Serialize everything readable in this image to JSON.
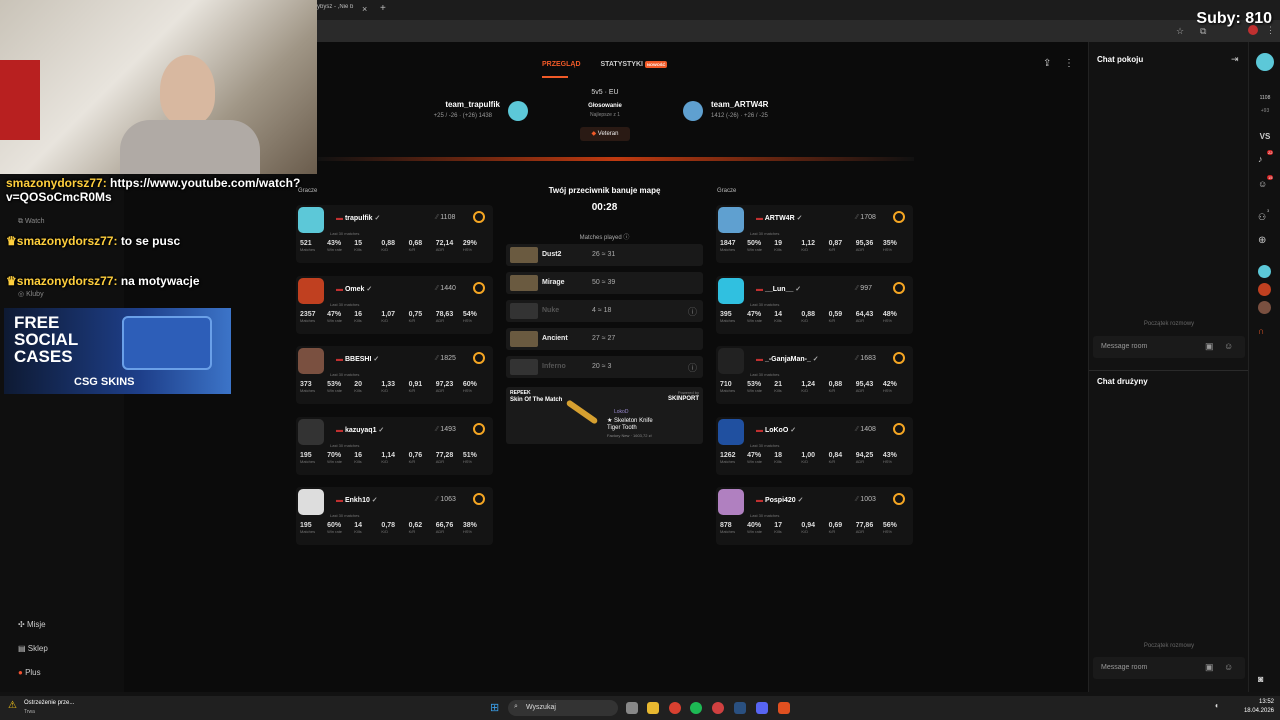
{
  "browser": {
    "tab_title": "ybysz - ,Nie b",
    "close": "×",
    "new_tab": "+"
  },
  "stream": {
    "subs": "Suby: 810"
  },
  "chat_overlay": [
    {
      "user": "smazonydorsz77:",
      "text": "https://www.youtube.com/watch?v=QOSoCmcR0Ms"
    },
    {
      "user": "smazonydorsz77:",
      "text": "to se pusc"
    },
    {
      "user": "smazonydorsz77:",
      "text": "na motywacje"
    }
  ],
  "promo": {
    "line1": "FREE",
    "line2": "SOCIAL",
    "line3": "CASES",
    "brand": "CSG SKINS"
  },
  "leftnav": {
    "watch": "Watch",
    "clubs": "Kluby",
    "bottom": [
      {
        "label": "Misje",
        "icon": "missions-icon"
      },
      {
        "label": "Sklep",
        "icon": "shop-icon"
      },
      {
        "label": "Plus",
        "icon": "plus-icon"
      }
    ]
  },
  "tabs": {
    "overview": "PRZEGLĄD",
    "stats": "STATYSTYKI",
    "new_badge": "NOWOŚĆ"
  },
  "match": {
    "team1": {
      "name": "team_trapulfik",
      "points": "+25 / -26 · (+26) 1438"
    },
    "team2": {
      "name": "team_ARTW4R",
      "points": "1412 (-26) · +26 / -25"
    },
    "mode": "5v5 · EU",
    "voting": "Głosowanie",
    "best": "Najlepsze z 1",
    "level": "Veteran",
    "ban_title": "Twój przeciwnik banuje mapę",
    "timer": "00:28",
    "players_label": "Gracze",
    "matches_played": "Matches played"
  },
  "maps": [
    {
      "name": "Dust2",
      "score": "26 ≈ 31"
    },
    {
      "name": "Mirage",
      "score": "50 ≈ 39"
    },
    {
      "name": "Nuke",
      "score": "4 ≈ 18"
    },
    {
      "name": "Ancient",
      "score": "27 ≈ 27"
    },
    {
      "name": "Inferno",
      "score": "20 ≈ 3"
    }
  ],
  "skin": {
    "label1": "REPEEK",
    "label2": "Skin Of The Match",
    "powered": "Powered by",
    "sponsor": "SKINPORT",
    "user": "LokoD",
    "item1": "★ Skeleton Knife",
    "item2": "Tiger Tooth",
    "condition": "Factory New · 1603,72 zł"
  },
  "stat_labels": [
    "Matches",
    "Win rate",
    "Kills",
    "K/D",
    "K/R",
    "ADR",
    "HS%"
  ],
  "last30": "Last 30 matches",
  "team_left": [
    {
      "name": "trapulfik",
      "elo": "1108",
      "stats": [
        "521",
        "43%",
        "15",
        "0,88",
        "0,68",
        "72,14",
        "29%"
      ],
      "color": "#5cc8d8"
    },
    {
      "name": "Omek",
      "elo": "1440",
      "stats": [
        "2357",
        "47%",
        "16",
        "1,07",
        "0,75",
        "78,63",
        "54%"
      ],
      "color": "#c04020"
    },
    {
      "name": "BBESHI",
      "elo": "1825",
      "stats": [
        "373",
        "53%",
        "20",
        "1,33",
        "0,91",
        "97,23",
        "60%"
      ],
      "color": "#7a5040"
    },
    {
      "name": "kazuyaq1",
      "elo": "1493",
      "stats": [
        "195",
        "70%",
        "16",
        "1,14",
        "0,76",
        "77,28",
        "51%"
      ],
      "color": "#333"
    },
    {
      "name": "Enkh10",
      "elo": "1063",
      "stats": [
        "195",
        "60%",
        "14",
        "0,78",
        "0,62",
        "66,76",
        "38%"
      ],
      "color": "#ddd"
    }
  ],
  "team_right": [
    {
      "name": "ARTW4R",
      "elo": "1708",
      "stats": [
        "1847",
        "50%",
        "19",
        "1,12",
        "0,87",
        "95,36",
        "35%"
      ],
      "color": "#5fa0d0"
    },
    {
      "name": "__Lun__",
      "elo": "997",
      "stats": [
        "395",
        "47%",
        "14",
        "0,88",
        "0,59",
        "64,43",
        "48%"
      ],
      "color": "#30c0e0"
    },
    {
      "name": "_-GanjaMan-_",
      "elo": "1683",
      "stats": [
        "710",
        "53%",
        "21",
        "1,24",
        "0,88",
        "95,43",
        "42%"
      ],
      "color": "#222"
    },
    {
      "name": "LoKoO",
      "elo": "1408",
      "stats": [
        "1262",
        "47%",
        "18",
        "1,00",
        "0,84",
        "94,25",
        "43%"
      ],
      "color": "#2050a0"
    },
    {
      "name": "Pospi420",
      "elo": "1003",
      "stats": [
        "878",
        "40%",
        "17",
        "0,94",
        "0,69",
        "77,86",
        "56%"
      ],
      "color": "#b080c0"
    }
  ],
  "room_chat": {
    "title": "Chat pokoju",
    "start": "Początek rozmowy",
    "placeholder": "Message room"
  },
  "team_chat": {
    "title": "Chat drużyny",
    "start": "Początek rozmowy",
    "placeholder": "Message room"
  },
  "rail": {
    "coins": "1108",
    "extra": "+93",
    "vs": "VS",
    "badge1": "22",
    "badge2": "15",
    "badge3": "3"
  },
  "taskbar": {
    "notification": "Ostrzeżenie prze...",
    "notif_sub": "Trwa",
    "search": "Wyszukaj",
    "time": "13:52",
    "date": "18.04.2026"
  }
}
